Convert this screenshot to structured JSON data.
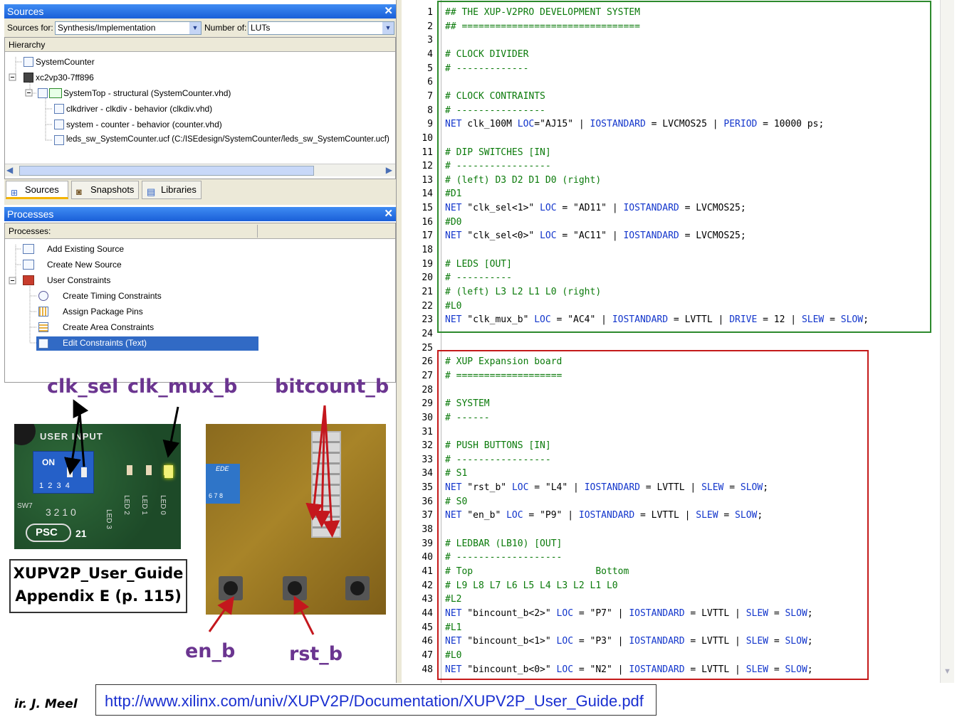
{
  "sources_panel": {
    "title": "Sources",
    "sources_for_label": "Sources for:",
    "sources_for_value": "Synthesis/Implementation",
    "number_of_label": "Number of:",
    "number_of_value": "LUTs",
    "hierarchy_label": "Hierarchy",
    "tree": [
      "SystemCounter",
      "xc2vp30-7ff896",
      "SystemTop - structural (SystemCounter.vhd)",
      "clkdriver - clkdiv - behavior (clkdiv.vhd)",
      "system - counter - behavior (counter.vhd)",
      "leds_sw_SystemCounter.ucf (C:/ISEdesign/SystemCounter/leds_sw_SystemCounter.ucf)"
    ],
    "tabs": [
      "Sources",
      "Snapshots",
      "Libraries"
    ]
  },
  "processes_panel": {
    "title": "Processes",
    "processes_label": "Processes:",
    "items": [
      "Add Existing Source",
      "Create New Source",
      "User Constraints",
      "Create Timing Constraints",
      "Assign Package Pins",
      "Create Area Constraints",
      "Edit Constraints (Text)"
    ]
  },
  "annotations": {
    "clk_sel": "clk_sel",
    "clk_mux_b": "clk_mux_b",
    "bitcount_b": "bitcount_b",
    "en_b": "en_b",
    "rst_b": "rst_b",
    "guide_line1": "XUPV2P_User_Guide",
    "guide_line2": "Appendix E (p. 115)",
    "switch_on": "ON",
    "switch_nums": "1  2  3  4",
    "switch_bits": "3 2 1 0",
    "sw7": "SW7",
    "user_input": "USER INPUT",
    "psc": "PSC",
    "led_labels": [
      "LED 3",
      "LED 2",
      "LED 1",
      "LED 0"
    ],
    "dip_nums": "6 7 8"
  },
  "footer": {
    "author": "ir. J. Meel",
    "url": "http://www.xilinx.com/univ/XUPV2P/Documentation/XUPV2P_User_Guide.pdf"
  },
  "code_lines": [
    "## THE XUP-V2PRO DEVELOPMENT SYSTEM",
    "## ================================",
    "",
    "# CLOCK DIVIDER",
    "# -------------",
    "",
    "# CLOCK CONTRAINTS",
    "# ----------------",
    "NET clk_100M LOC=\"AJ15\" | IOSTANDARD = LVCMOS25 | PERIOD = 10000 ps;",
    "",
    "# DIP SWITCHES [IN]",
    "# -----------------",
    "# (left) D3 D2 D1 D0 (right)",
    "#D1",
    "NET \"clk_sel<1>\" LOC = \"AD11\" | IOSTANDARD = LVCMOS25;",
    "#D0",
    "NET \"clk_sel<0>\" LOC = \"AC11\" | IOSTANDARD = LVCMOS25;",
    "",
    "# LEDS [OUT]",
    "# ----------",
    "# (left) L3 L2 L1 L0 (right)",
    "#L0",
    "NET \"clk_mux_b\" LOC = \"AC4\" | IOSTANDARD = LVTTL | DRIVE = 12 | SLEW = SLOW;",
    "",
    "",
    "# XUP Expansion board",
    "# ===================",
    "",
    "# SYSTEM",
    "# ------",
    "",
    "# PUSH BUTTONS [IN]",
    "# -----------------",
    "# S1",
    "NET \"rst_b\" LOC = \"L4\" | IOSTANDARD = LVTTL | SLEW = SLOW;",
    "# S0",
    "NET \"en_b\" LOC = \"P9\" | IOSTANDARD = LVTTL | SLEW = SLOW;",
    "",
    "# LEDBAR (LB10) [OUT]",
    "# -------------------",
    "# Top                      Bottom",
    "# L9 L8 L7 L6 L5 L4 L3 L2 L1 L0",
    "#L2",
    "NET \"bincount_b<2>\" LOC = \"P7\" | IOSTANDARD = LVTTL | SLEW = SLOW;",
    "#L1",
    "NET \"bincount_b<1>\" LOC = \"P3\" | IOSTANDARD = LVTTL | SLEW = SLOW;",
    "#L0",
    "NET \"bincount_b<0>\" LOC = \"N2\" | IOSTANDARD = LVTTL | SLEW = SLOW;"
  ],
  "colors": {
    "comment": "#0a7a0a",
    "keyword": "#1336cc",
    "title_bar": "#2a6ee6",
    "selected": "#316ac5",
    "annotation_text": "#6b3590",
    "arrow_red": "#c4171d",
    "green_box": "#2d8a2d",
    "red_box": "#c41a1a"
  }
}
